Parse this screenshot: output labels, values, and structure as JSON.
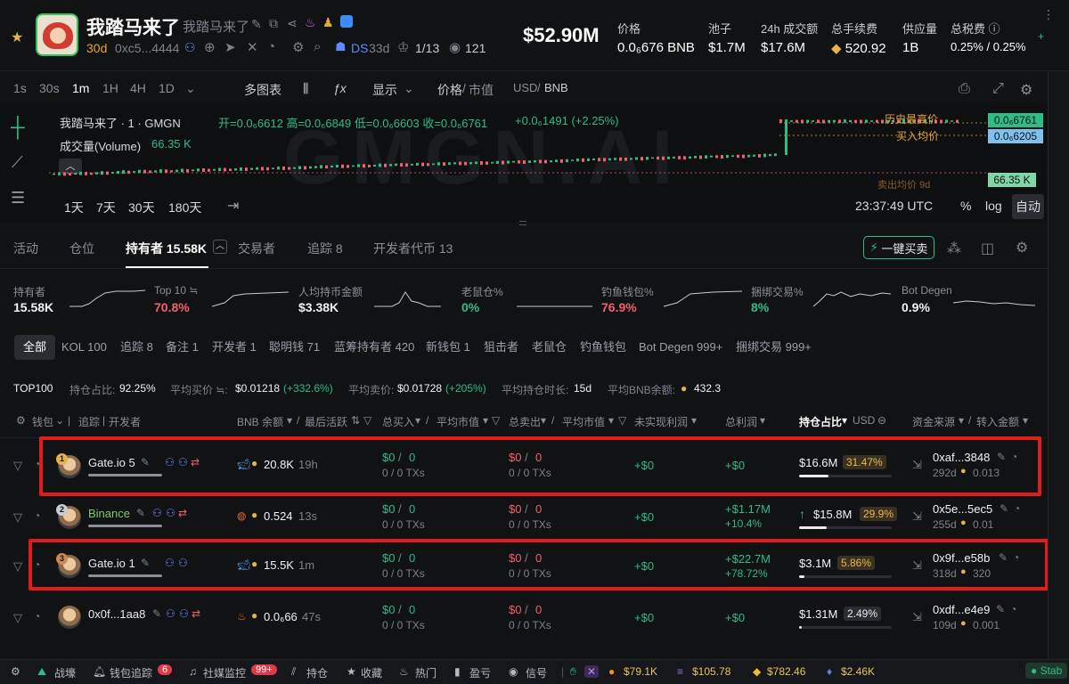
{
  "header": {
    "token_name": "我踏马来了",
    "token_name_sub": "我踏马来了",
    "age": "30d",
    "address": "0xc5...4444",
    "ds_label": "DS",
    "ds_age": "33d",
    "rank": "1/13",
    "views": "121",
    "market_cap": "$52.90M",
    "stats": [
      {
        "label": "价格",
        "value": "0.0₆676 BNB"
      },
      {
        "label": "池子",
        "value": "$1.7M"
      },
      {
        "label": "24h 成交额",
        "value": "$17.6M"
      },
      {
        "label": "总手续费",
        "value": "520.92"
      },
      {
        "label": "供应量",
        "value": "1B"
      },
      {
        "label": "总税费",
        "value": "0.25% / 0.25%"
      }
    ]
  },
  "chart_toolbar": {
    "intervals": [
      "1s",
      "30s",
      "1m",
      "1H",
      "4H",
      "1D"
    ],
    "active_interval": "1m",
    "multi_chart": "多图表",
    "display": "显示",
    "price_label": "价格",
    "mcap_label": "市值",
    "usd": "USD",
    "bnb": "BNB"
  },
  "chart": {
    "title": "我踏马来了 · 1 · GMGN",
    "ohlc": "开=0.0₆6612  高=0.0₆6849  低=0.0₆6603  收=0.0₆6761",
    "change": "+0.0₆1491 (+2.25%)",
    "volume_label": "成交量(Volume)",
    "volume_value": "66.35 K",
    "watermark": "GMGN.AI",
    "ath_label": "历史最高价",
    "avg_buy_label": "买入均价",
    "avg_sell_label": "卖出均价 9d",
    "price_tag": "0.0₆6761",
    "price_tag2": "0.0₆6205",
    "volume_tag": "66.35 K",
    "ranges": [
      "1天",
      "7天",
      "30天",
      "180天"
    ],
    "time": "23:37:49 UTC",
    "pct": "%",
    "log": "log",
    "auto": "自动"
  },
  "tabs": {
    "items": [
      "活动",
      "仓位",
      "持有者 15.58K",
      "交易者",
      "追踪 8",
      "开发者代币 13"
    ],
    "active": "持有者 15.58K",
    "quick_buy": "一键买卖"
  },
  "metrics": [
    {
      "label": "持有者",
      "value": "15.58K",
      "color": "#f1f2f4"
    },
    {
      "label": "Top 10 ≒",
      "value": "70.8%",
      "color": "#f0616d"
    },
    {
      "label": "人均持币金额",
      "value": "$3.38K",
      "color": "#f1f2f4"
    },
    {
      "label": "老鼠仓%",
      "value": "0%",
      "color": "#2ebd85"
    },
    {
      "label": "钓鱼钱包%",
      "value": "76.9%",
      "color": "#f0616d"
    },
    {
      "label": "捆绑交易%",
      "value": "8%",
      "color": "#2ebd85"
    },
    {
      "label": "Bot Degen",
      "value": "0.9%",
      "color": "#f1f2f4"
    }
  ],
  "filters": [
    "全部",
    "KOL 100",
    "追踪 8",
    "备注 1",
    "开发者 1",
    "聪明钱 71",
    "蓝筹持有者 420",
    "新钱包 1",
    "狙击者",
    "老鼠仓",
    "钓鱼钱包",
    "Bot Degen 999+",
    "捆绑交易 999+"
  ],
  "summary": {
    "top": "TOP100",
    "hold_ratio_label": "持仓占比:",
    "hold_ratio": "92.25%",
    "avg_buy_label": "平均买价 ≒:",
    "avg_buy": "$0.01218",
    "avg_buy_change": "(+332.6%)",
    "avg_sell_label": "平均卖价:",
    "avg_sell": "$0.01728",
    "avg_sell_change": "(+205%)",
    "avg_hold_label": "平均持仓时长:",
    "avg_hold": "15d",
    "avg_bnb_label": "平均BNB余额:",
    "avg_bnb": "432.3"
  },
  "table_headers": [
    "钱包",
    "追踪",
    "开发者",
    "BNB 余额",
    "最后活跃",
    "总买入",
    "平均市值",
    "总卖出",
    "平均市值",
    "未实现利润",
    "总利润",
    "持仓占比",
    "USD",
    "资金来源",
    "转入金额"
  ],
  "rows": [
    {
      "rank": "1",
      "name": "Gate.io 5",
      "name_color": "#e8eaee",
      "bnb": "20.8K",
      "active": "19h",
      "buy": "$0",
      "buy_amt": "0",
      "buy_tx": "0 / 0 TXs",
      "sell": "$0",
      "sell_amt": "0",
      "sell_tx": "0 / 0 TXs",
      "unrealized": "+$0",
      "profit": "+$0",
      "profit_pct": "",
      "hold_usd": "$16.6M",
      "hold_pct": "31.47%",
      "hold_fill": 0.3147,
      "source": "0xaf...3848",
      "source_age": "292d",
      "source_amt": "0.013"
    },
    {
      "rank": "2",
      "name": "Binance",
      "name_color": "#7fc96a",
      "bnb": "0.524",
      "active": "13s",
      "buy": "$0",
      "buy_amt": "0",
      "buy_tx": "0 / 0 TXs",
      "sell": "$0",
      "sell_amt": "0",
      "sell_tx": "0 / 0 TXs",
      "unrealized": "+$0",
      "profit": "+$1.17M",
      "profit_pct": "+10.4%",
      "hold_usd": "$15.8M",
      "hold_pct": "29.9%",
      "hold_fill": 0.299,
      "source": "0x5e...5ec5",
      "source_age": "255d",
      "source_amt": "0.01"
    },
    {
      "rank": "3",
      "name": "Gate.io 1",
      "name_color": "#e8eaee",
      "bnb": "15.5K",
      "active": "1m",
      "buy": "$0",
      "buy_amt": "0",
      "buy_tx": "0 / 0 TXs",
      "sell": "$0",
      "sell_amt": "0",
      "sell_tx": "0 / 0 TXs",
      "unrealized": "+$0",
      "profit": "+$22.7M",
      "profit_pct": "+78.72%",
      "hold_usd": "$3.1M",
      "hold_pct": "5.86%",
      "hold_fill": 0.0586,
      "source": "0x9f...e58b",
      "source_age": "318d",
      "source_amt": "320"
    },
    {
      "rank": "4",
      "name": "0x0f...1aa8",
      "name_color": "#e8eaee",
      "bnb": "0.0₆66",
      "active": "47s",
      "buy": "$0",
      "buy_amt": "0",
      "buy_tx": "0 / 0 TXs",
      "sell": "$0",
      "sell_amt": "0",
      "sell_tx": "0 / 0 TXs",
      "unrealized": "+$0",
      "profit": "+$0",
      "profit_pct": "",
      "hold_usd": "$1.31M",
      "hold_pct": "2.49%",
      "hold_fill": 0.0249,
      "source": "0xdf...e4e9",
      "source_age": "109d",
      "source_amt": "0.001"
    }
  ],
  "bottom": {
    "items": [
      "战壕",
      "钱包追踪",
      "社媒监控",
      "持仓",
      "收藏",
      "热门",
      "盈亏",
      "信号"
    ],
    "wallet_badge": "6",
    "social_badge": "99+",
    "btc": "$79.1K",
    "sol": "$105.78",
    "bnb": "$782.46",
    "eth": "$2.46K",
    "status": "Stab"
  }
}
